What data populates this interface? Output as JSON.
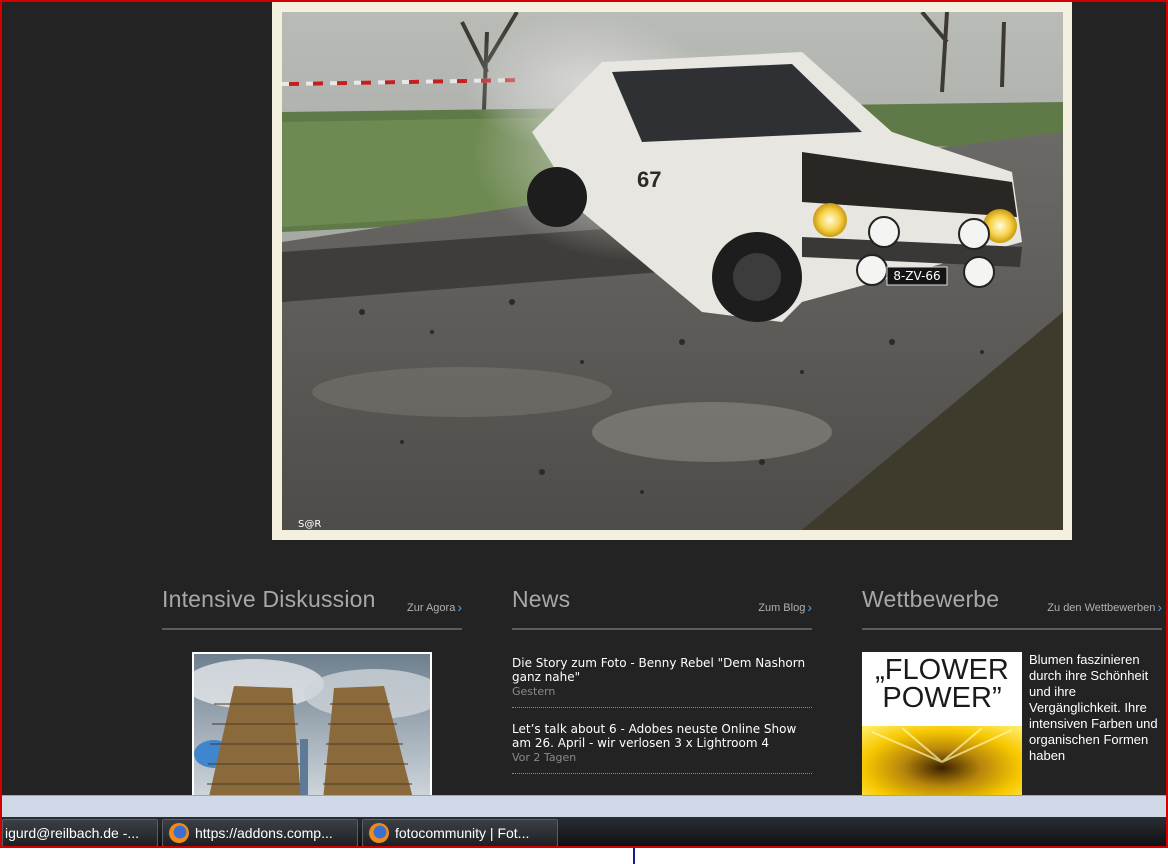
{
  "hero": {
    "credit": "S@R",
    "plate": "8-ZV-66",
    "car_number": "67"
  },
  "columns": {
    "discussion": {
      "title": "Intensive Diskussion",
      "link": "Zur Agora"
    },
    "news": {
      "title": "News",
      "link": "Zum Blog",
      "items": [
        {
          "title": "Die Story zum Foto - Benny Rebel \"Dem Nashorn ganz nahe\"",
          "date": "Gestern"
        },
        {
          "title": "Let’s talk about 6 - Adobes neuste Online Show am 26. April - wir verlosen 3 x Lightroom 4",
          "date": "Vor 2 Tagen"
        }
      ]
    },
    "contests": {
      "title": "Wettbewerbe",
      "link": "Zu den Wettbewerben",
      "thumb_text_line1": "„FLOWER",
      "thumb_text_line2": "POWER”",
      "description": "Blumen faszinieren durch ihre Schönheit und ihre Vergänglichkeit. Ihre intensiven Farben und organischen Formen haben"
    }
  },
  "taskbar": {
    "items": [
      {
        "label": "igurd@reilbach.de -..."
      },
      {
        "label": "https://addons.comp..."
      },
      {
        "label": "fotocommunity | Fot..."
      }
    ]
  },
  "colors": {
    "background": "#232323",
    "border": "#d40000",
    "link_chevron": "#4ea0e0"
  }
}
